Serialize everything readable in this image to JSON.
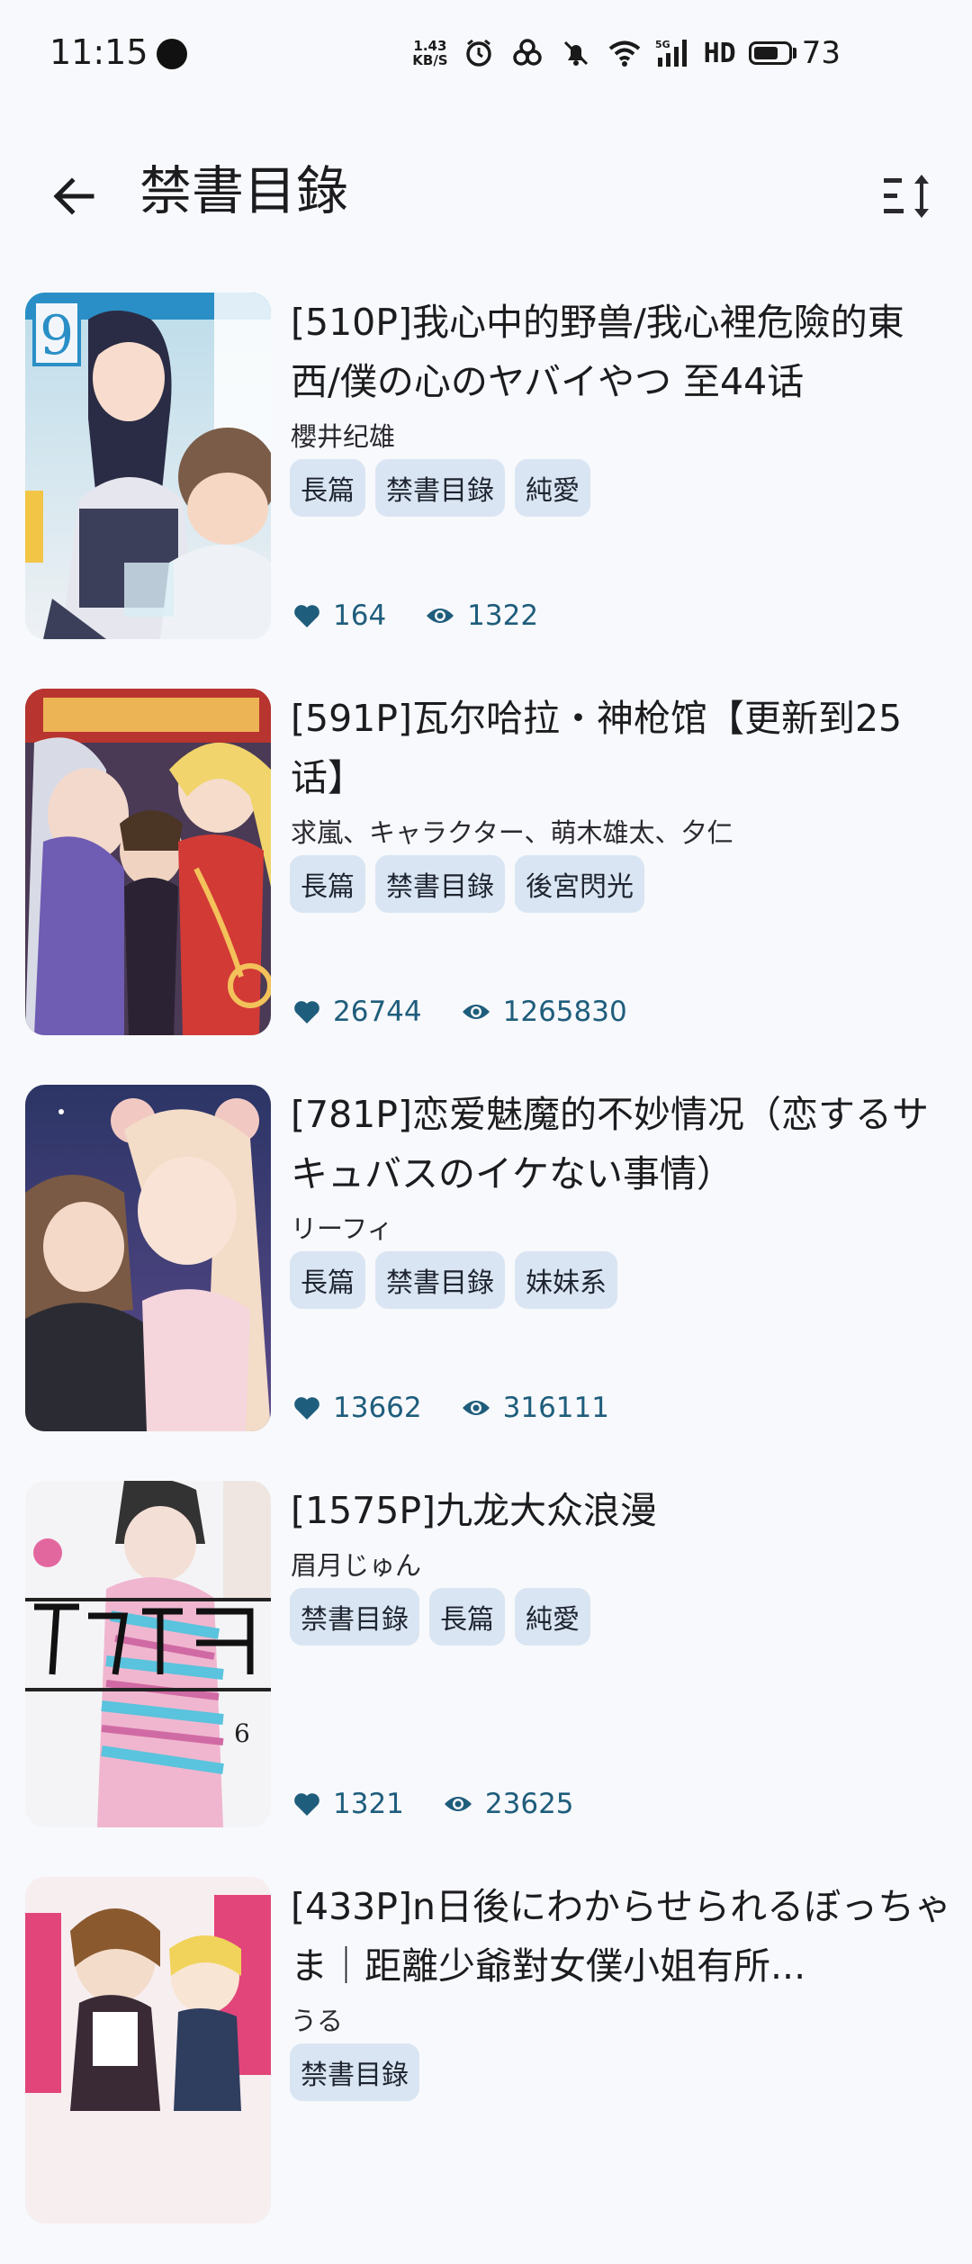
{
  "status_bar": {
    "time": "11:15",
    "net_speed_value": "1.43",
    "net_speed_unit": "KB/S",
    "network_label": "HD",
    "battery_percent": "73",
    "battery_level": 0.73
  },
  "app_bar": {
    "title": "禁書目錄"
  },
  "items": [
    {
      "title": "[510P]我心中的野兽/我心裡危險的東西/僕の心のヤバイやつ 至44话",
      "author": "櫻井纪雄",
      "tags": [
        "長篇",
        "禁書目錄",
        "純愛"
      ],
      "likes": "164",
      "views": "1322",
      "cover_text": "9"
    },
    {
      "title": "[591P]瓦尔哈拉・神枪馆【更新到25话】",
      "author": "求嵐、キャラクター、萌木雄太、夕仁",
      "tags": [
        "長篇",
        "禁書目錄",
        "後宮閃光"
      ],
      "likes": "26744",
      "views": "1265830"
    },
    {
      "title": "[781P]恋爱魅魔的不妙情况（恋するサキュバスのイケない事情）",
      "author": "リーフィ",
      "tags": [
        "長篇",
        "禁書目錄",
        "妹妹系"
      ],
      "likes": "13662",
      "views": "316111"
    },
    {
      "title": "[1575P]九龙大众浪漫",
      "author": "眉月じゅん",
      "tags": [
        "禁書目錄",
        "長篇",
        "純愛"
      ],
      "likes": "1321",
      "views": "23625",
      "cover_text": "6"
    },
    {
      "title": "[433P]n日後にわからせられるぼっちゃま｜距離少爺對女僕小姐有所...",
      "author": "うる",
      "tags": [
        "禁書目錄"
      ],
      "likes": "",
      "views": ""
    }
  ],
  "colors": {
    "background": "#f8f9fc",
    "tag_background": "#d9e5f2",
    "stat_color": "#1f5d7c"
  }
}
